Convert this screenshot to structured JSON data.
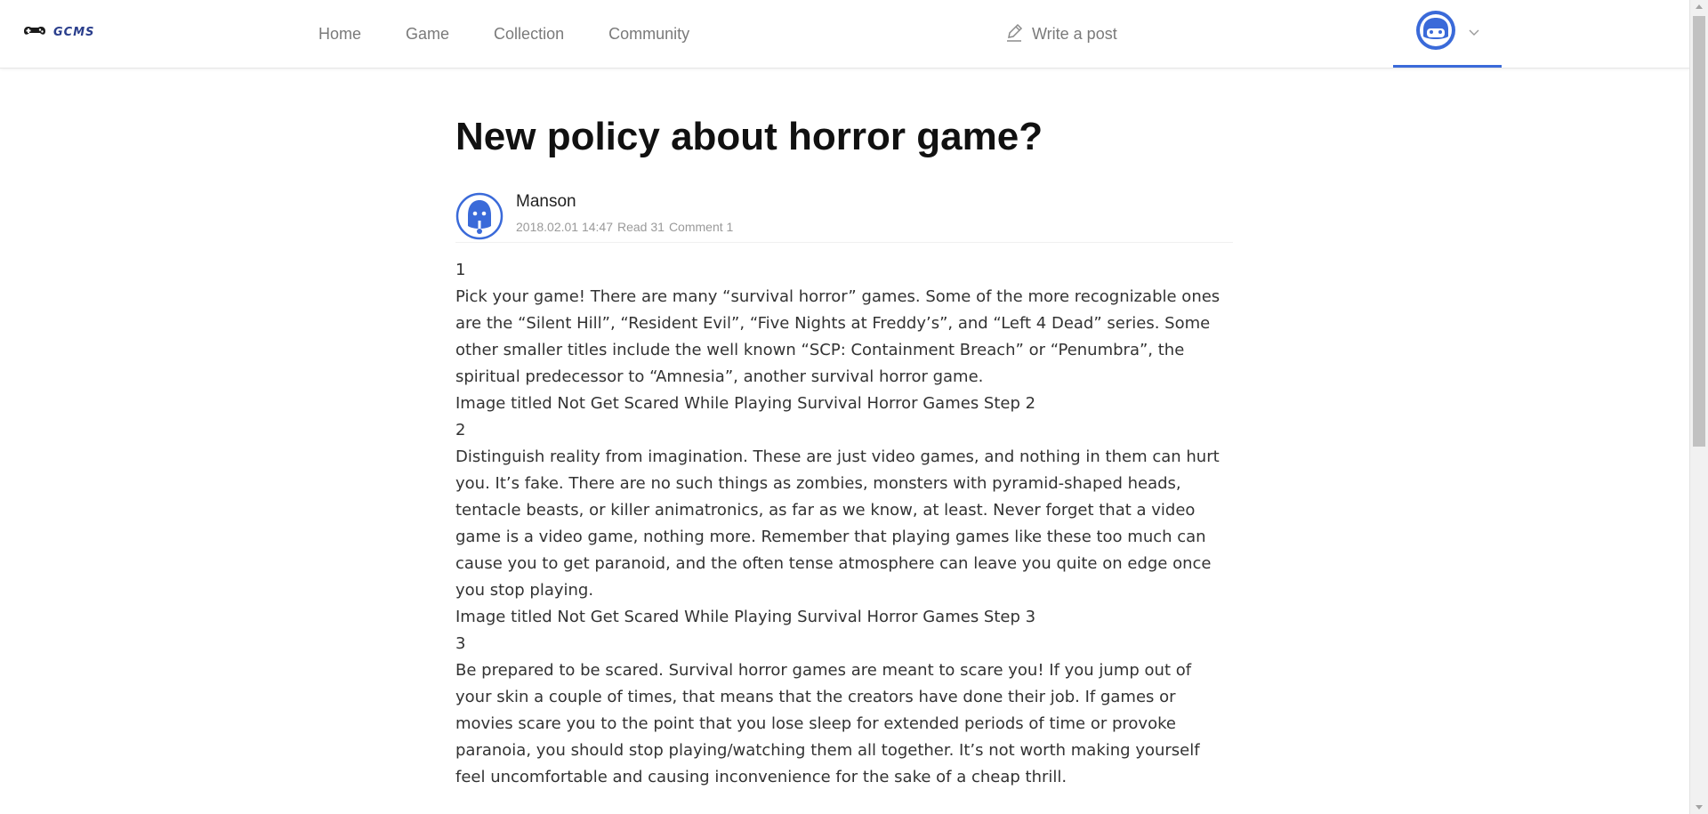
{
  "header": {
    "logo_text": "GCMS",
    "nav": [
      {
        "label": "Home"
      },
      {
        "label": "Game"
      },
      {
        "label": "Collection"
      },
      {
        "label": "Community"
      }
    ],
    "write_post_label": "Write a post",
    "user_menu": {
      "avatar_icon": "robot-avatar-icon",
      "dropdown_icon": "chevron-down-icon"
    }
  },
  "article": {
    "title": "New policy about horror game?",
    "author": {
      "name": "Manson",
      "date": "2018.02.01 14:47",
      "read": "Read 31",
      "comment": "Comment 1"
    },
    "paragraphs": [
      "1",
      "Pick your game! There are many “survival horror” games. Some of the more recognizable ones are the “Silent Hill”, “Resident Evil”, “Five Nights at Freddy’s”, and “Left 4 Dead” series. Some other smaller titles include the well known “SCP: Containment Breach” or “Penumbra”, the spiritual predecessor to “Amnesia”, another survival horror game.",
      "Image titled Not Get Scared While Playing Survival Horror Games Step 2",
      "2",
      "Distinguish reality from imagination. These are just video games, and nothing in them can hurt you. It’s fake. There are no such things as zombies, monsters with pyramid-shaped heads, tentacle beasts, or killer animatronics, as far as we know, at least. Never forget that a video game is a video game, nothing more. Remember that playing games like these too much can cause you to get paranoid, and the often tense atmosphere can leave you quite on edge once you stop playing.",
      "Image titled Not Get Scared While Playing Survival Horror Games Step 3",
      "3",
      "Be prepared to be scared. Survival horror games are meant to scare you! If you jump out of your skin a couple of times, that means that the creators have done their job. If games or movies scare you to the point that you lose sleep for extended periods of time or provoke paranoia, you should stop playing/watching them all together. It’s not worth making yourself feel uncomfortable and causing inconvenience for the sake of a cheap thrill."
    ]
  },
  "colors": {
    "accent": "#3a6ad9",
    "nav_text": "#7a7a7a",
    "title_text": "#111111",
    "body_text": "#333333",
    "meta_text": "#9a9a9a"
  }
}
